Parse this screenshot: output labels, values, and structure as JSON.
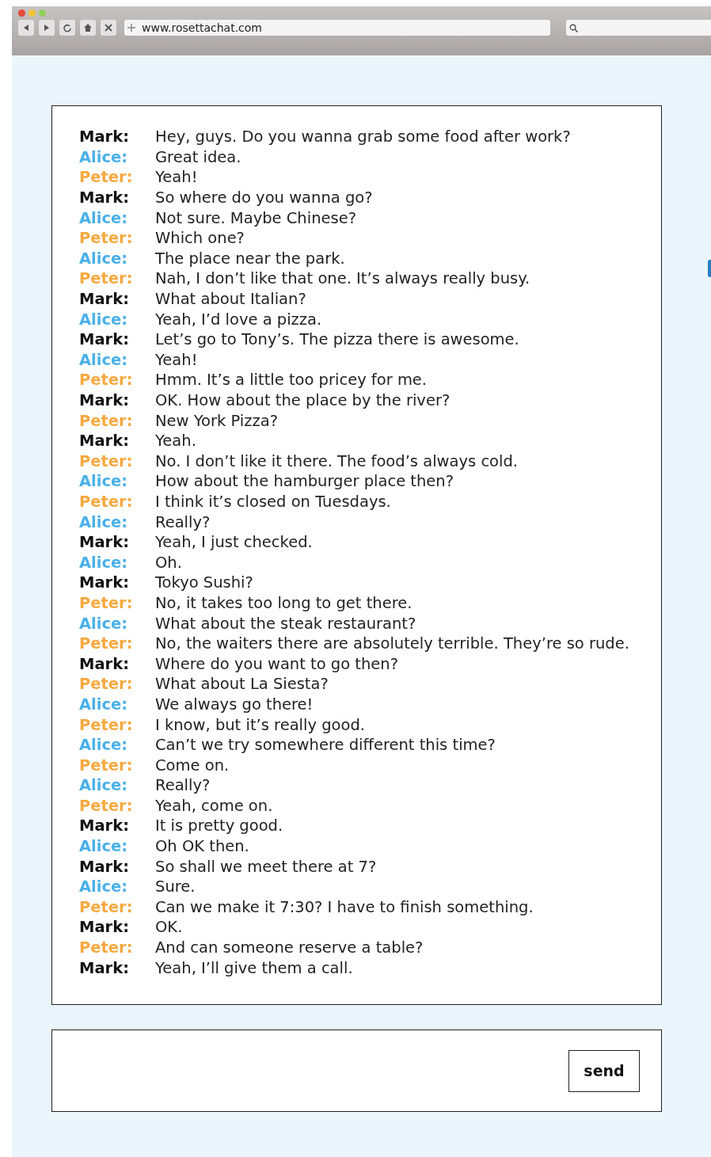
{
  "browser": {
    "url": "www.rosettachat.com"
  },
  "messages": [
    {
      "speaker": "Mark:",
      "color": "#111111",
      "text": "Hey, guys. Do you wanna grab some food after work?"
    },
    {
      "speaker": "Alice:",
      "color": "#4ab0e8",
      "text": "Great idea."
    },
    {
      "speaker": "Peter:",
      "color": "#f7a940",
      "text": "Yeah!"
    },
    {
      "speaker": "Mark:",
      "color": "#111111",
      "text": "So where do you wanna go?"
    },
    {
      "speaker": "Alice:",
      "color": "#4ab0e8",
      "text": "Not sure. Maybe Chinese?"
    },
    {
      "speaker": "Peter:",
      "color": "#f7a940",
      "text": "Which one?"
    },
    {
      "speaker": "Alice:",
      "color": "#4ab0e8",
      "text": "The place near the park."
    },
    {
      "speaker": "Peter:",
      "color": "#f7a940",
      "text": "Nah, I don’t like that one. It’s always really busy."
    },
    {
      "speaker": "Mark:",
      "color": "#111111",
      "text": "What about Italian?"
    },
    {
      "speaker": "Alice:",
      "color": "#4ab0e8",
      "text": "Yeah, I’d love a pizza."
    },
    {
      "speaker": "Mark:",
      "color": "#111111",
      "text": "Let’s go to Tony’s. The pizza there is awesome."
    },
    {
      "speaker": "Alice:",
      "color": "#4ab0e8",
      "text": "Yeah!"
    },
    {
      "speaker": "Peter:",
      "color": "#f7a940",
      "text": "Hmm. It’s a little too pricey for me."
    },
    {
      "speaker": "Mark:",
      "color": "#111111",
      "text": "OK. How about the place by the river?"
    },
    {
      "speaker": "Peter:",
      "color": "#f7a940",
      "text": "New York Pizza?"
    },
    {
      "speaker": "Mark:",
      "color": "#111111",
      "text": "Yeah."
    },
    {
      "speaker": "Peter:",
      "color": "#f7a940",
      "text": "No. I don’t like it there. The food’s always cold."
    },
    {
      "speaker": "Alice:",
      "color": "#4ab0e8",
      "text": "How about the hamburger place then?"
    },
    {
      "speaker": "Peter:",
      "color": "#f7a940",
      "text": "I think it’s closed on Tuesdays."
    },
    {
      "speaker": "Alice:",
      "color": "#4ab0e8",
      "text": "Really?"
    },
    {
      "speaker": "Mark:",
      "color": "#111111",
      "text": "Yeah, I just checked."
    },
    {
      "speaker": "Alice:",
      "color": "#4ab0e8",
      "text": "Oh."
    },
    {
      "speaker": "Mark:",
      "color": "#111111",
      "text": "Tokyo Sushi?"
    },
    {
      "speaker": "Peter:",
      "color": "#f7a940",
      "text": "No, it takes too long to get there."
    },
    {
      "speaker": "Alice:",
      "color": "#4ab0e8",
      "text": "What about the steak restaurant?"
    },
    {
      "speaker": "Peter:",
      "color": "#f7a940",
      "text": "No, the waiters there are absolutely terrible. They’re so rude."
    },
    {
      "speaker": "Mark:",
      "color": "#111111",
      "text": "Where do you want to go then?"
    },
    {
      "speaker": "Peter:",
      "color": "#f7a940",
      "text": "What about La Siesta?"
    },
    {
      "speaker": "Alice:",
      "color": "#4ab0e8",
      "text": "We always go there!"
    },
    {
      "speaker": "Peter:",
      "color": "#f7a940",
      "text": "I know, but it’s really good."
    },
    {
      "speaker": "Alice:",
      "color": "#4ab0e8",
      "text": "Can’t we try somewhere different this time?"
    },
    {
      "speaker": "Peter:",
      "color": "#f7a940",
      "text": "Come on."
    },
    {
      "speaker": "Alice:",
      "color": "#4ab0e8",
      "text": "Really?"
    },
    {
      "speaker": "Peter:",
      "color": "#f7a940",
      "text": "Yeah, come on."
    },
    {
      "speaker": "Mark:",
      "color": "#111111",
      "text": "It is pretty good."
    },
    {
      "speaker": "Alice:",
      "color": "#4ab0e8",
      "text": "Oh OK then."
    },
    {
      "speaker": "Mark:",
      "color": "#111111",
      "text": "So shall we meet there at 7?"
    },
    {
      "speaker": "Alice:",
      "color": "#4ab0e8",
      "text": "Sure."
    },
    {
      "speaker": "Peter:",
      "color": "#f7a940",
      "text": "Can we make it 7:30? I have to finish something."
    },
    {
      "speaker": "Mark:",
      "color": "#111111",
      "text": "OK."
    },
    {
      "speaker": "Peter:",
      "color": "#f7a940",
      "text": "And can someone reserve a table?"
    },
    {
      "speaker": "Mark:",
      "color": "#111111",
      "text": "Yeah, I’ll give them a call."
    }
  ],
  "composer": {
    "send_button": "send"
  }
}
